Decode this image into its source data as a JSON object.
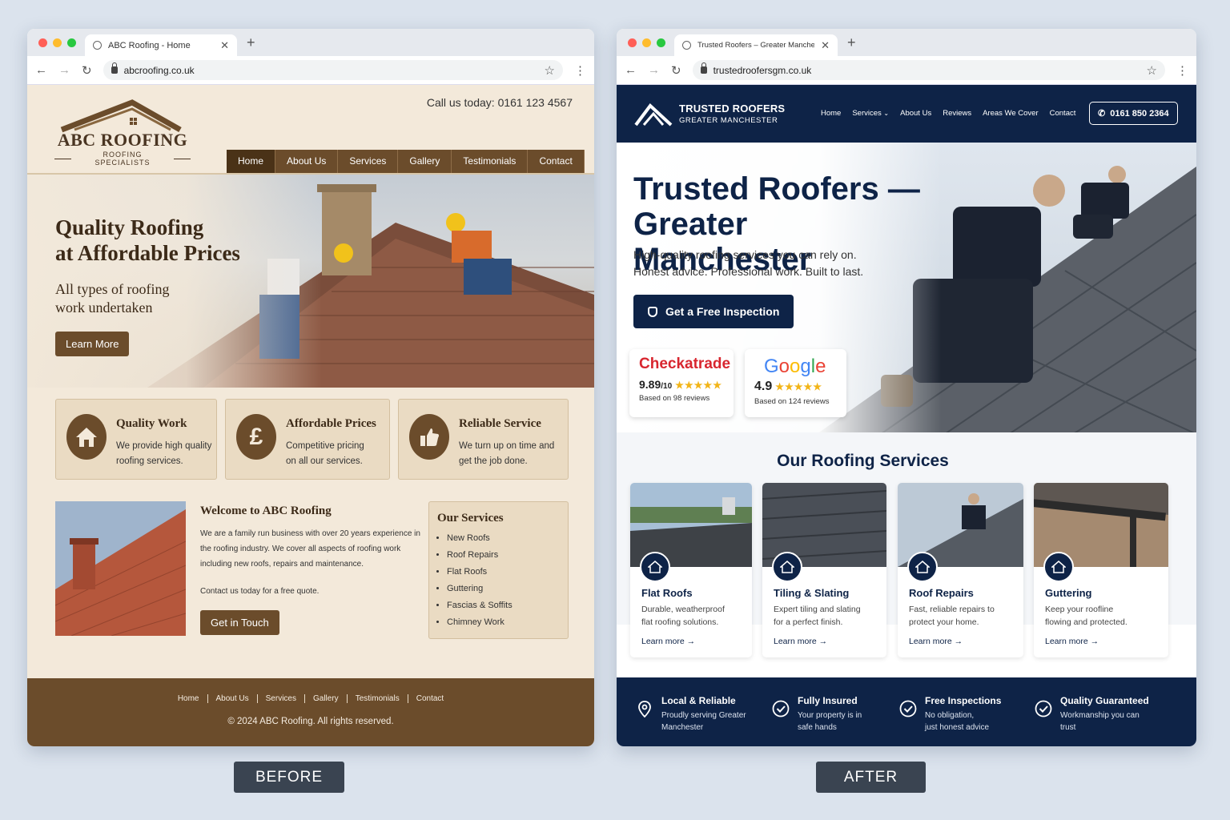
{
  "before": {
    "browser": {
      "tab_title": "ABC Roofing - Home",
      "url": "abcroofing.co.uk"
    },
    "header": {
      "logo_name": "ABC ROOFING",
      "logo_tagline": "ROOFING SPECIALISTS",
      "call": "Call us today: 0161 123 4567",
      "nav": [
        "Home",
        "About Us",
        "Services",
        "Gallery",
        "Testimonials",
        "Contact"
      ]
    },
    "hero": {
      "title_line1": "Quality Roofing",
      "title_line2": "at Affordable Prices",
      "tagline_line1": "All types of roofing",
      "tagline_line2": "work undertaken",
      "button": "Learn More"
    },
    "features": [
      {
        "title": "Quality Work",
        "line1": "We provide high quality",
        "line2": "roofing services.",
        "icon": "house-icon"
      },
      {
        "title": "Affordable Prices",
        "line1": "Competitive pricing",
        "line2": "on all our services.",
        "icon": "pound-icon"
      },
      {
        "title": "Reliable Service",
        "line1": "We turn up on time and",
        "line2": "get the job done.",
        "icon": "thumbs-up-icon"
      }
    ],
    "welcome": {
      "title": "Welcome to ABC Roofing",
      "line1": "We are a family run business with over 20 years experience in",
      "line2": "the roofing industry. We cover all aspects of roofing work",
      "line3": "including new roofs, repairs and maintenance.",
      "line4": "Contact us today for a free quote.",
      "button": "Get in Touch"
    },
    "services": {
      "title": "Our Services",
      "items": [
        "New Roofs",
        "Roof Repairs",
        "Flat Roofs",
        "Guttering",
        "Fascias & Soffits",
        "Chimney Work"
      ]
    },
    "footer": {
      "links": [
        "Home",
        "About Us",
        "Services",
        "Gallery",
        "Testimonials",
        "Contact"
      ],
      "copyright": "© 2024 ABC Roofing. All rights reserved."
    },
    "label": "BEFORE"
  },
  "after": {
    "browser": {
      "tab_title": "Trusted Roofers – Greater Manchester",
      "url": "trustedroofersgm.co.uk"
    },
    "header": {
      "logo_line1": "TRUSTED ROOFERS",
      "logo_line2": "GREATER MANCHESTER",
      "nav": [
        "Home",
        "Services",
        "About Us",
        "Reviews",
        "Areas We Cover",
        "Contact"
      ],
      "phone": "0161 850 2364"
    },
    "hero": {
      "title_line1": "Trusted Roofers —",
      "title_line2": "Greater Manchester",
      "sub_line1": "High-quality roofing services you can rely on.",
      "sub_line2": "Honest advice. Professional work. Built to last.",
      "cta": "Get a Free Inspection"
    },
    "reviews": [
      {
        "brand": "Checkatrade",
        "score": "9.89",
        "out_of": "/10",
        "stars": "★★★★★",
        "based": "Based on 98 reviews"
      },
      {
        "brand": "Google",
        "score": "4.9",
        "out_of": "",
        "stars": "★★★★★",
        "based": "Based on 124 reviews"
      }
    ],
    "services": {
      "title": "Our Roofing Services",
      "cards": [
        {
          "title": "Flat Roofs",
          "line1": "Durable, weatherproof",
          "line2": "flat roofing solutions.",
          "link": "Learn more"
        },
        {
          "title": "Tiling & Slating",
          "line1": "Expert tiling and slating",
          "line2": "for a perfect finish.",
          "link": "Learn more"
        },
        {
          "title": "Roof Repairs",
          "line1": "Fast, reliable repairs to",
          "line2": "protect your home.",
          "link": "Learn more"
        },
        {
          "title": "Guttering",
          "line1": "Keep your roofline",
          "line2": "flowing and protected.",
          "link": "Learn more"
        }
      ]
    },
    "footer": [
      {
        "title": "Local & Reliable",
        "line1": "Proudly serving Greater",
        "line2": "Manchester",
        "icon": "location-pin-icon"
      },
      {
        "title": "Fully Insured",
        "line1": "Your property is in",
        "line2": "safe hands",
        "icon": "check-circle-icon"
      },
      {
        "title": "Free Inspections",
        "line1": "No obligation,",
        "line2": "just honest advice",
        "icon": "check-circle-icon"
      },
      {
        "title": "Quality Guaranteed",
        "line1": "Workmanship you can",
        "line2": "trust",
        "icon": "check-circle-icon"
      }
    ],
    "label": "AFTER"
  }
}
